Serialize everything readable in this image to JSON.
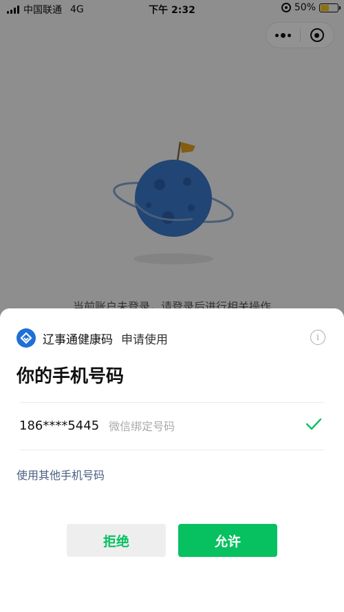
{
  "status_bar": {
    "carrier": "中国联通",
    "network": "4G",
    "time": "下午 2:32",
    "battery": "50%",
    "battery_level": 0.5
  },
  "background": {
    "notice": "当前账户未登录，请登录后进行相关操作",
    "planet_color": "#3a78c9",
    "flag_color": "#e0a020"
  },
  "capsule": {
    "menu_icon": "more-dots-icon",
    "close_icon": "target-circle-icon"
  },
  "sheet": {
    "app_name": "辽事通健康码",
    "request_text": "申请使用",
    "title": "你的手机号码",
    "phone_number": "186****5445",
    "phone_tag": "微信绑定号码",
    "other_phone_link": "使用其他手机号码",
    "reject_label": "拒绝",
    "allow_label": "允许",
    "accent_color": "#07c160",
    "link_color": "#4a5d80"
  }
}
